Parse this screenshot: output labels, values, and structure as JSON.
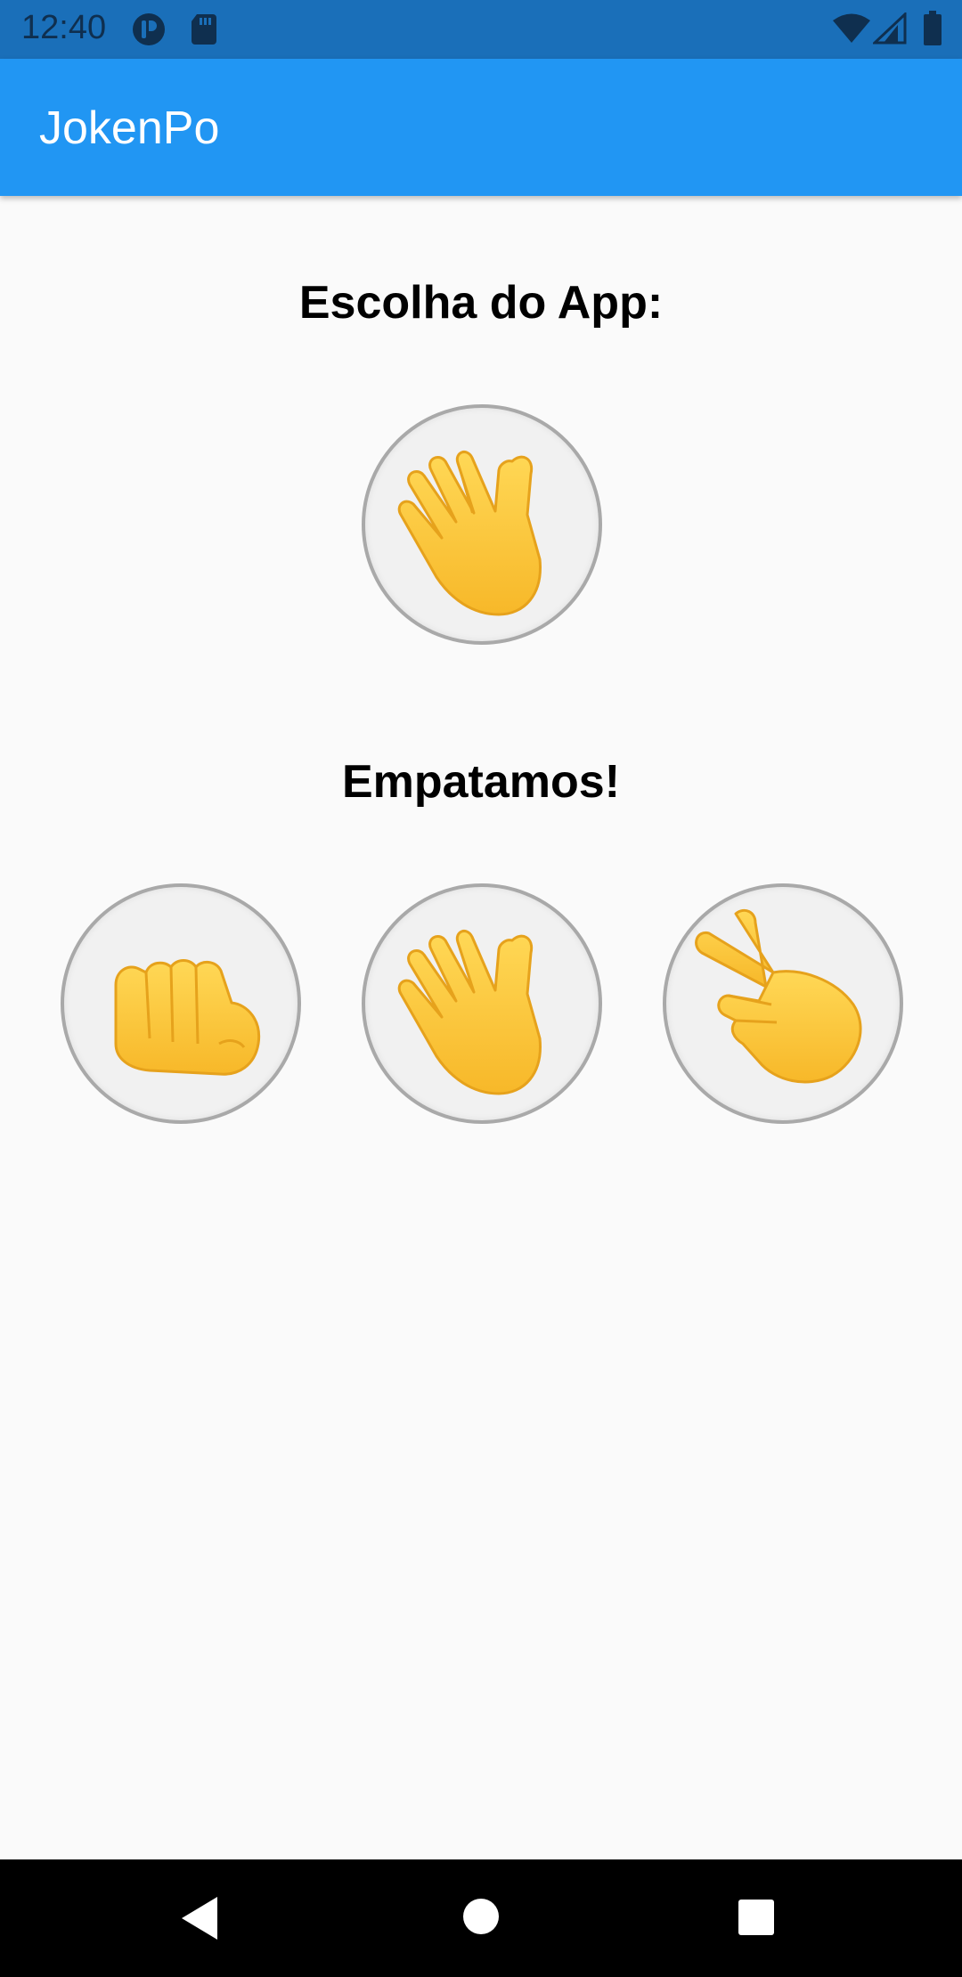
{
  "status_bar": {
    "time": "12:40",
    "icons": [
      "app-notification-icon",
      "sd-card-icon",
      "wifi-icon",
      "cell-signal-icon",
      "battery-icon"
    ]
  },
  "app_bar": {
    "title": "JokenPo",
    "color": "#2196f3"
  },
  "main": {
    "app_choice_heading": "Escolha do App:",
    "app_choice_icon": "hand-paper-icon",
    "result_message": "Empatamos!",
    "options": [
      {
        "name": "rock",
        "icon": "fist-rock-icon"
      },
      {
        "name": "paper",
        "icon": "hand-paper-icon"
      },
      {
        "name": "scissors",
        "icon": "victory-scissors-icon"
      }
    ]
  },
  "nav_bar": {
    "icons": [
      "back-icon",
      "home-icon",
      "recents-icon"
    ]
  }
}
